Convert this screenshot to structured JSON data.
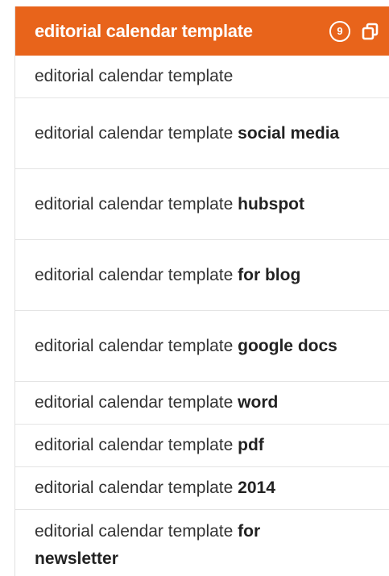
{
  "header": {
    "title": "editorial calendar template",
    "count": "9",
    "copy_icon": "copy-icon",
    "background_color": "#e8641b"
  },
  "suggestions": [
    {
      "base": "editorial calendar template",
      "suffix": ""
    },
    {
      "base": "editorial calendar template",
      "suffix": "social media"
    },
    {
      "base": "editorial calendar template",
      "suffix": "hubspot"
    },
    {
      "base": "editorial calendar template",
      "suffix": "for blog"
    },
    {
      "base": "editorial calendar template",
      "suffix": "google docs"
    },
    {
      "base": "editorial calendar template",
      "suffix": "word"
    },
    {
      "base": "editorial calendar template",
      "suffix": "pdf"
    },
    {
      "base": "editorial calendar template",
      "suffix": "2014"
    },
    {
      "base": "editorial calendar template",
      "suffix": "for newsletter"
    }
  ]
}
